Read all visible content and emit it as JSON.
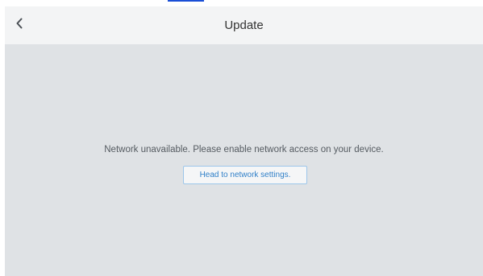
{
  "header": {
    "back_icon": "chevron-left-icon",
    "title": "Update"
  },
  "main": {
    "message": "Network unavailable. Please enable network access on your device.",
    "action_label": "Head to network settings."
  },
  "colors": {
    "header_bg": "#f3f4f5",
    "content_bg": "#dfe2e5",
    "button_text": "#2f7fc8",
    "button_border": "#9cc6ea"
  }
}
